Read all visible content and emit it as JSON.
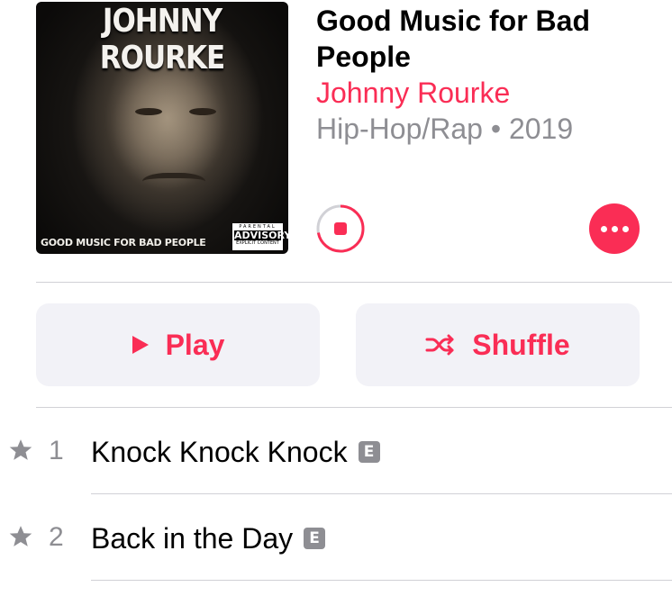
{
  "album": {
    "cover": {
      "artist_text": "JOHNNY ROURKE",
      "subtitle_text": "GOOD MUSIC FOR BAD PEOPLE",
      "advisory_line1": "PARENTAL",
      "advisory_line2": "ADVISORY",
      "advisory_line3": "EXPLICIT CONTENT"
    },
    "title": "Good Music for Bad People",
    "artist": "Johnny Rourke",
    "genre_year": "Hip-Hop/Rap • 2019"
  },
  "controls": {
    "download_progress": 0.72,
    "accent_color": "#fa2d55"
  },
  "actions": {
    "play_label": "Play",
    "shuffle_label": "Shuffle"
  },
  "tracks": [
    {
      "number": "1",
      "title": "Knock Knock Knock",
      "explicit_badge": "E",
      "starred": true
    },
    {
      "number": "2",
      "title": "Back in the Day",
      "explicit_badge": "E",
      "starred": true
    }
  ]
}
